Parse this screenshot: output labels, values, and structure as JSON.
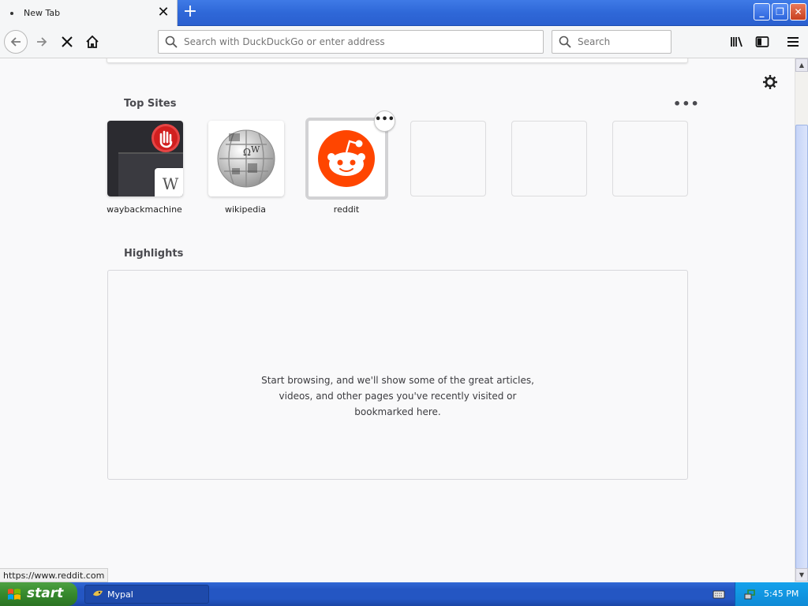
{
  "browser": {
    "tab_title": "New Tab",
    "url_placeholder": "Search with DuckDuckGo or enter address",
    "search_placeholder": "Search"
  },
  "newtab": {
    "top_sites_title": "Top Sites",
    "highlights_title": "Highlights",
    "top_sites": [
      {
        "label": "waybackmachine",
        "icon": "wayback-thumbnail",
        "letter": "W"
      },
      {
        "label": "wikipedia",
        "icon": "wikipedia-globe"
      },
      {
        "label": "reddit",
        "icon": "reddit-logo",
        "accent": "#ff4500"
      }
    ],
    "empty_slots": 3,
    "highlights_message": [
      "Start browsing, and we'll show some of the great articles,",
      "videos, and other pages you've recently visited or",
      "bookmarked here."
    ]
  },
  "status": {
    "hover_url": "https://www.reddit.com"
  },
  "taskbar": {
    "start_label": "start",
    "task_label": "Mypal",
    "clock": "5:45 PM"
  },
  "colors": {
    "xp_blue": "#2456c3",
    "start_green": "#36892c",
    "reddit_orange": "#ff4500",
    "tray_blue": "#0f8ad6"
  }
}
